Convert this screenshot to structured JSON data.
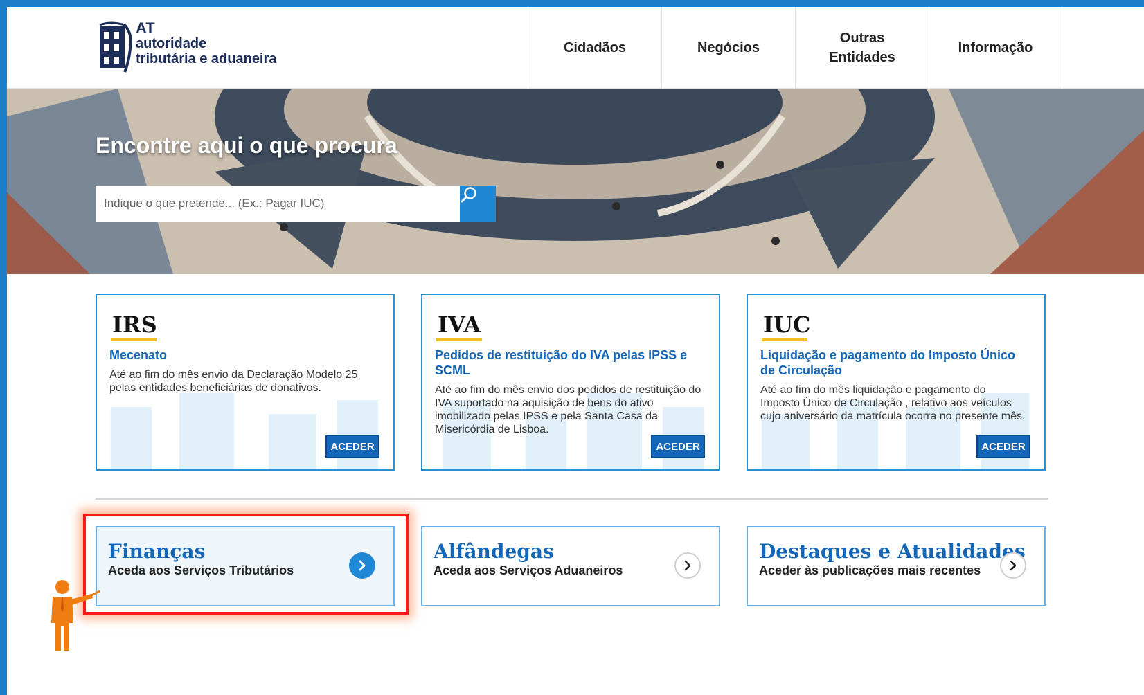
{
  "logo": {
    "line1": "AT",
    "line2": "autoridade",
    "line3": "tributária e aduaneira"
  },
  "nav": {
    "items": [
      {
        "label": "Cidadãos"
      },
      {
        "label": "Negócios"
      },
      {
        "label": "Outras Entidades"
      },
      {
        "label": "Informação"
      }
    ]
  },
  "hero": {
    "title": "Encontre aqui o que procura",
    "search_placeholder": "Indique o que pretende... (Ex.: Pagar IUC)"
  },
  "cards": [
    {
      "title": "IRS",
      "subtitle": "Mecenato",
      "description": "Até ao fim do mês envio da Declaração Modelo 25 pelas entidades beneficiárias de donativos.",
      "button": "ACEDER"
    },
    {
      "title": "IVA",
      "subtitle": "Pedidos de restituição do IVA pelas IPSS e SCML",
      "description": "Até ao fim do mês envio dos pedidos de restituição do IVA suportado na aquisição de bens do ativo imobilizado pelas IPSS e pela Santa Casa da Misericórdia de Lisboa.",
      "button": "ACEDER"
    },
    {
      "title": "IUC",
      "subtitle": "Liquidação e pagamento do Imposto Único de Circulação",
      "description": "Até ao fim do mês liquidação e pagamento do Imposto Único de Circulação , relativo aos veículos cujo aniversário da matrícula ocorra no presente mês.",
      "button": "ACEDER"
    }
  ],
  "links": [
    {
      "title": "Finanças",
      "subtitle": "Aceda aos Serviços Tributários"
    },
    {
      "title": "Alfândegas",
      "subtitle": "Aceda aos Serviços Aduaneiros"
    },
    {
      "title": "Destaques e Atualidades",
      "subtitle": "Aceder às publicações mais recentes"
    }
  ],
  "colors": {
    "brand_blue": "#1466b8",
    "accent_blue": "#1e88d6",
    "underline_yellow": "#f0c024",
    "highlight_red": "#ff1a1a",
    "frame_blue": "#1c7fc8"
  },
  "icons": {
    "search": "search-icon",
    "chevron": "chevron-right-icon",
    "presenter": "presenter-figure-icon"
  }
}
